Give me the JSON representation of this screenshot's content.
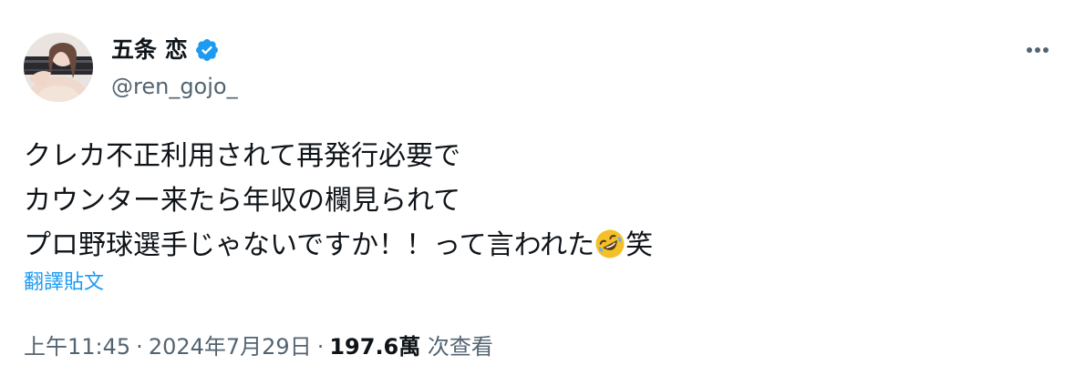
{
  "author": {
    "display_name": "五条 恋",
    "handle": "@ren_gojo_",
    "verified": true
  },
  "tweet": {
    "lines": [
      "クレカ不正利用されて再発行必要で",
      "カウンター来たら年収の欄見られて",
      "プロ野球選手じゃないですか！！って言われた"
    ],
    "line3_after_emoji": "笑",
    "emoji": "rolling-on-the-floor-laughing"
  },
  "actions": {
    "translate_label": "翻譯貼文",
    "more_icon": "more-horizontal-icon"
  },
  "meta": {
    "time": "上午11:45",
    "separator": "·",
    "date": "2024年7月29日",
    "views_count": "197.6萬",
    "views_label": "次查看"
  },
  "colors": {
    "text_primary": "#0f1419",
    "text_secondary": "#536471",
    "accent": "#1d9bf0"
  }
}
